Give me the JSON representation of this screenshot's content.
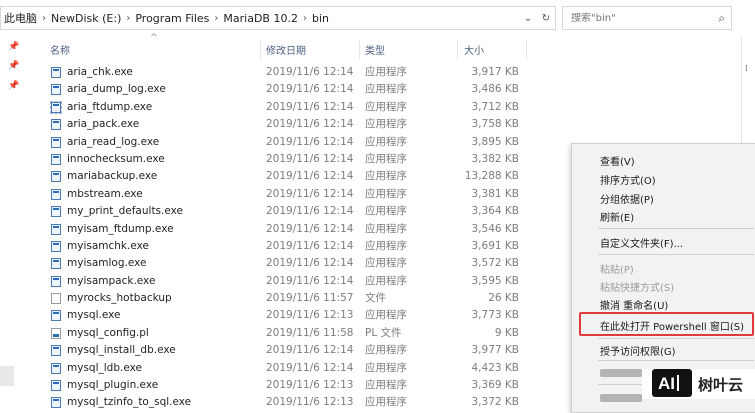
{
  "address": {
    "crumbs": [
      "此电脑",
      "NewDisk (E:)",
      "Program Files",
      "MariaDB 10.2",
      "bin"
    ],
    "dropdown_icon": "chevron-down-icon",
    "refresh_icon": "refresh-icon"
  },
  "search": {
    "placeholder": "搜索\"bin\"",
    "icon": "search-icon"
  },
  "columns": {
    "name": "名称",
    "date": "修改日期",
    "type": "类型",
    "size": "大小"
  },
  "files": [
    {
      "name": "aria_chk.exe",
      "date": "2019/11/6 12:14",
      "type": "应用程序",
      "size": "3,917 KB",
      "icon": "exe"
    },
    {
      "name": "aria_dump_log.exe",
      "date": "2019/11/6 12:14",
      "type": "应用程序",
      "size": "3,486 KB",
      "icon": "exe"
    },
    {
      "name": "aria_ftdump.exe",
      "date": "2019/11/6 12:14",
      "type": "应用程序",
      "size": "3,712 KB",
      "icon": "exe"
    },
    {
      "name": "aria_pack.exe",
      "date": "2019/11/6 12:14",
      "type": "应用程序",
      "size": "3,758 KB",
      "icon": "exe"
    },
    {
      "name": "aria_read_log.exe",
      "date": "2019/11/6 12:14",
      "type": "应用程序",
      "size": "3,895 KB",
      "icon": "exe"
    },
    {
      "name": "innochecksum.exe",
      "date": "2019/11/6 12:14",
      "type": "应用程序",
      "size": "3,382 KB",
      "icon": "exe"
    },
    {
      "name": "mariabackup.exe",
      "date": "2019/11/6 12:14",
      "type": "应用程序",
      "size": "13,288 KB",
      "icon": "exe"
    },
    {
      "name": "mbstream.exe",
      "date": "2019/11/6 12:14",
      "type": "应用程序",
      "size": "3,381 KB",
      "icon": "exe"
    },
    {
      "name": "my_print_defaults.exe",
      "date": "2019/11/6 12:14",
      "type": "应用程序",
      "size": "3,364 KB",
      "icon": "exe"
    },
    {
      "name": "myisam_ftdump.exe",
      "date": "2019/11/6 12:14",
      "type": "应用程序",
      "size": "3,546 KB",
      "icon": "exe"
    },
    {
      "name": "myisamchk.exe",
      "date": "2019/11/6 12:14",
      "type": "应用程序",
      "size": "3,691 KB",
      "icon": "exe"
    },
    {
      "name": "myisamlog.exe",
      "date": "2019/11/6 12:14",
      "type": "应用程序",
      "size": "3,572 KB",
      "icon": "exe"
    },
    {
      "name": "myisampack.exe",
      "date": "2019/11/6 12:14",
      "type": "应用程序",
      "size": "3,595 KB",
      "icon": "exe"
    },
    {
      "name": "myrocks_hotbackup",
      "date": "2019/11/6 11:57",
      "type": "文件",
      "size": "26 KB",
      "icon": "doc"
    },
    {
      "name": "mysql.exe",
      "date": "2019/11/6 12:13",
      "type": "应用程序",
      "size": "3,773 KB",
      "icon": "exe"
    },
    {
      "name": "mysql_config.pl",
      "date": "2019/11/6 11:58",
      "type": "PL 文件",
      "size": "9 KB",
      "icon": "pl"
    },
    {
      "name": "mysql_install_db.exe",
      "date": "2019/11/6 12:14",
      "type": "应用程序",
      "size": "3,977 KB",
      "icon": "exe"
    },
    {
      "name": "mysql_ldb.exe",
      "date": "2019/11/6 12:14",
      "type": "应用程序",
      "size": "4,423 KB",
      "icon": "exe"
    },
    {
      "name": "mysql_plugin.exe",
      "date": "2019/11/6 12:13",
      "type": "应用程序",
      "size": "3,369 KB",
      "icon": "exe"
    },
    {
      "name": "mysql_tzinfo_to_sql.exe",
      "date": "2019/11/6 12:13",
      "type": "应用程序",
      "size": "3,372 KB",
      "icon": "exe"
    }
  ],
  "context_menu": {
    "view": "查看(V)",
    "sort": "排序方式(O)",
    "group": "分组依据(P)",
    "refresh": "刷新(E)",
    "customize": "自定义文件夹(F)...",
    "paste": "粘贴(P)",
    "paste_shortcut": "粘贴快捷方式(S)",
    "undo_rename": "撤消 重命名(U)",
    "powershell": "在此处打开 Powershell 窗口(S)",
    "grant_access": "授予访问权限(G)",
    "submenu_arrow": "chevron-right-icon",
    "highlight_color": "#e23a3a"
  },
  "watermark": {
    "logo_text": "AI",
    "text": "树叶云"
  }
}
